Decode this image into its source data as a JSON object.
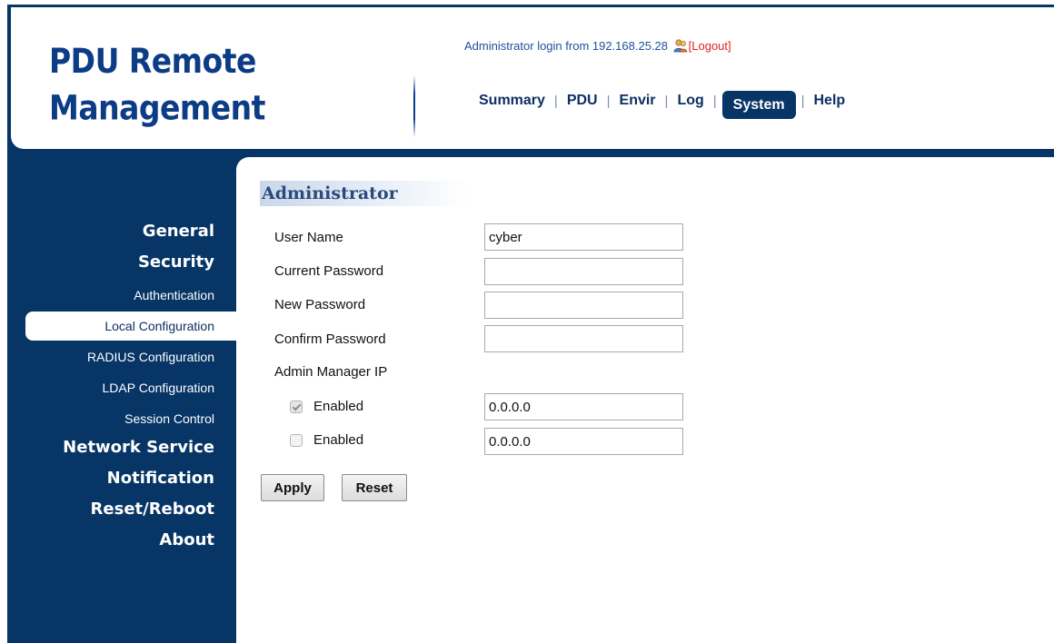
{
  "header": {
    "logo_line1": "PDU Remote",
    "logo_line2": "Management",
    "login_text": "Administrator login from 192.168.25.28",
    "logout_label": "[Logout]"
  },
  "topnav": {
    "items": [
      "Summary",
      "PDU",
      "Envir",
      "Log",
      "System",
      "Help"
    ],
    "separator": "|",
    "active": "System"
  },
  "sidebar": {
    "items": [
      {
        "label": "General",
        "level": "main"
      },
      {
        "label": "Security",
        "level": "main"
      },
      {
        "label": "Authentication",
        "level": "sub"
      },
      {
        "label": "Local Configuration",
        "level": "sub",
        "active": true
      },
      {
        "label": "RADIUS Configuration",
        "level": "sub"
      },
      {
        "label": "LDAP Configuration",
        "level": "sub"
      },
      {
        "label": "Session Control",
        "level": "sub"
      },
      {
        "label": "Network Service",
        "level": "main"
      },
      {
        "label": "Notification",
        "level": "main"
      },
      {
        "label": "Reset/Reboot",
        "level": "main"
      },
      {
        "label": "About",
        "level": "main"
      }
    ]
  },
  "form": {
    "title": "Administrator",
    "user_name_label": "User Name",
    "user_name_value": "cyber",
    "current_password_label": "Current Password",
    "current_password_value": "",
    "new_password_label": "New Password",
    "new_password_value": "",
    "confirm_password_label": "Confirm Password",
    "confirm_password_value": "",
    "admin_manager_ip_label": "Admin Manager IP",
    "ip_rows": [
      {
        "enabled_label": "Enabled",
        "checked": true,
        "ip": "0.0.0.0"
      },
      {
        "enabled_label": "Enabled",
        "checked": false,
        "ip": "0.0.0.0"
      }
    ],
    "apply_label": "Apply",
    "reset_label": "Reset"
  },
  "icons": {
    "login_user": "user-icon"
  },
  "colors": {
    "navy": "#063566",
    "logo_blue": "#0d3c86",
    "logout_red": "#e02020"
  }
}
